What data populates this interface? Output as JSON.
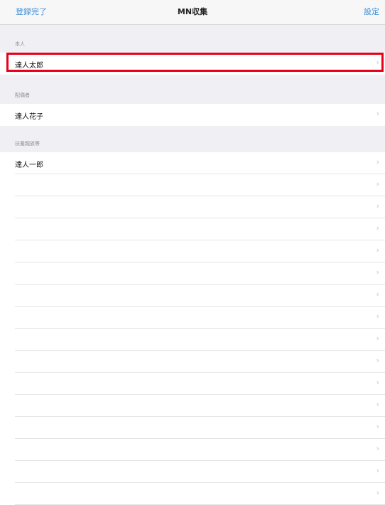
{
  "nav": {
    "left_label": "登録完了",
    "title": "MN収集",
    "right_label": "設定"
  },
  "sections": [
    {
      "header": "本人",
      "rows": [
        {
          "label": "達人太郎"
        }
      ]
    },
    {
      "header": "配偶者",
      "rows": [
        {
          "label": "達人花子"
        }
      ]
    },
    {
      "header": "扶養親族等",
      "rows": [
        {
          "label": "達人一郎"
        }
      ]
    }
  ],
  "chevron": "›",
  "empty_rows_count": 15,
  "highlight_color": "#e8001a",
  "accent_color": "#3b8ed8"
}
